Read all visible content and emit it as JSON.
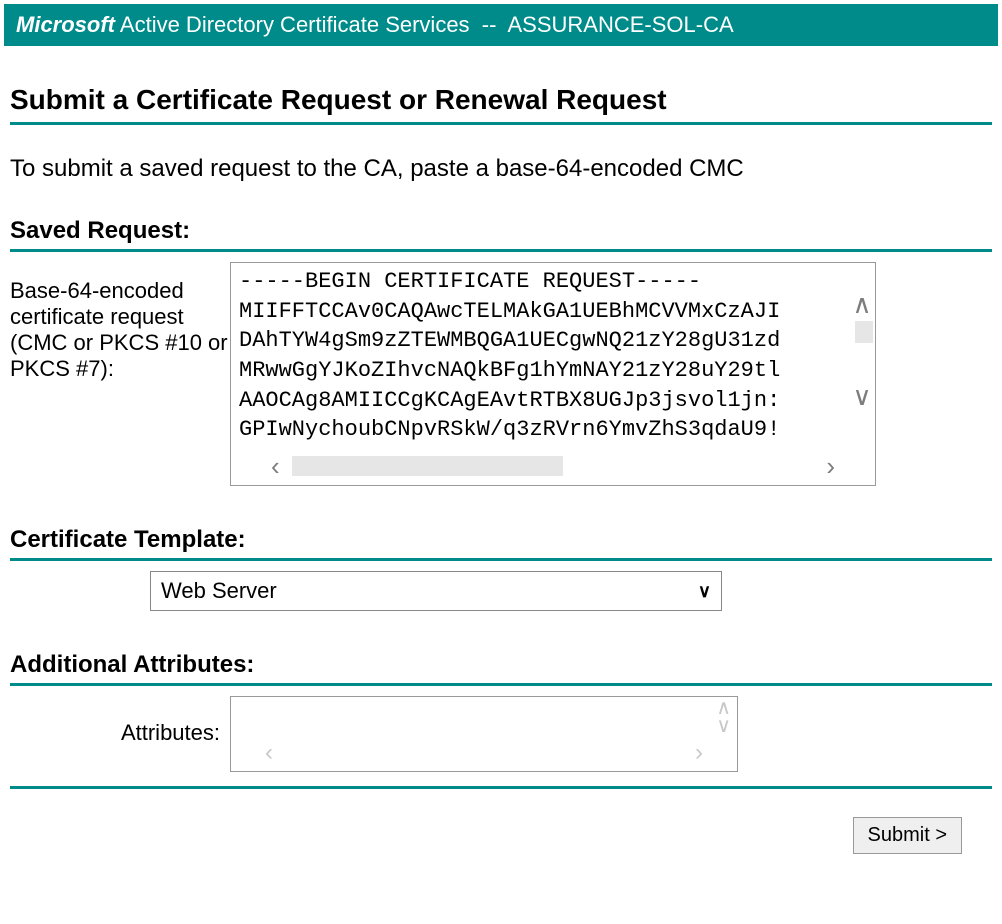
{
  "header": {
    "brand": "Microsoft",
    "service": "Active Directory Certificate Services",
    "separator": "--",
    "ca_name": "ASSURANCE-SOL-CA"
  },
  "page": {
    "title": "Submit a Certificate Request or Renewal Request",
    "intro": "To submit a saved request to the CA, paste a base-64-encoded CMC"
  },
  "saved_request": {
    "section_label": "Saved Request:",
    "field_label": "Base-64-encoded certificate request (CMC or PKCS #10 or PKCS #7):",
    "lines": [
      "-----BEGIN CERTIFICATE REQUEST-----",
      "MIIFFTCCAv0CAQAwcTELMAkGA1UEBhMCVVMxCzAJI",
      "DAhTYW4gSm9zZTEWMBQGA1UECgwNQ21zY28gU31zd",
      "MRwwGgYJKoZIhvcNAQkBFg1hYmNAY21zY28uY29tl",
      "AAOCAg8AMIICCgKCAgEAvtRTBX8UGJp3jsvol1jn:",
      "GPIwNychoubCNpvRSkW/q3zRVrn6YmvZhS3qdaU9!"
    ]
  },
  "certificate_template": {
    "section_label": "Certificate Template:",
    "selected": "Web Server"
  },
  "additional_attributes": {
    "section_label": "Additional Attributes:",
    "field_label": "Attributes:",
    "value": ""
  },
  "actions": {
    "submit_label": "Submit >"
  }
}
